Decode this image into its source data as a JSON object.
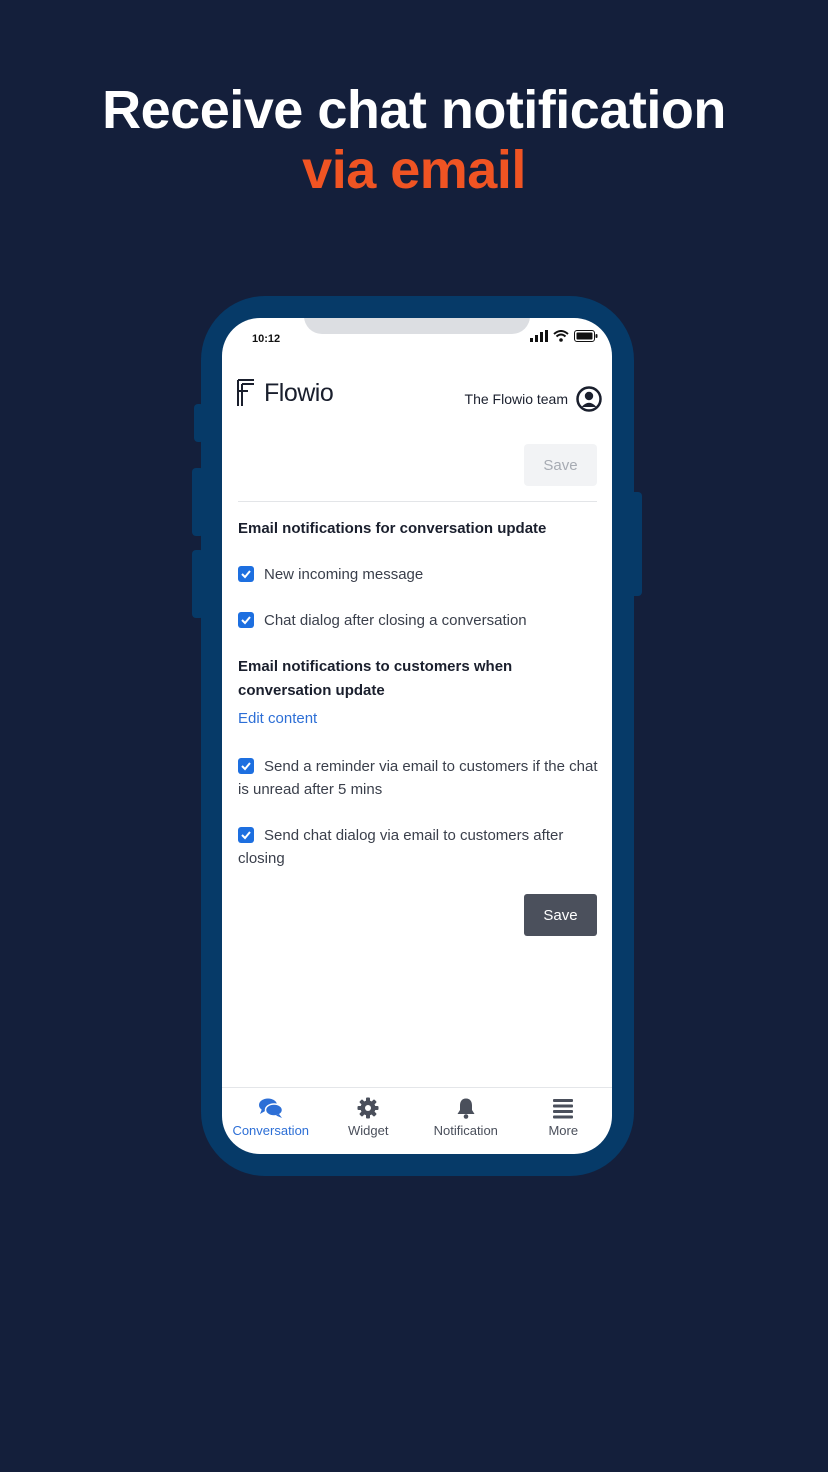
{
  "hero": {
    "line1": "Receive chat notification",
    "line2": "via email"
  },
  "colors": {
    "background": "#141f3b",
    "accent": "#f05423",
    "phone_frame": "#063a68",
    "link": "#2d6fd6",
    "checkbox": "#1d6fe0"
  },
  "status_bar": {
    "time": "10:12",
    "icons": [
      "signal-icon",
      "wifi-icon",
      "battery-icon"
    ]
  },
  "header": {
    "brand": "Flowio",
    "account_name": "The Flowio team",
    "account_icon": "user-circle-icon"
  },
  "top_save": {
    "label": "Save",
    "state": "disabled"
  },
  "section1": {
    "title": "Email notifications for conversation update",
    "options": [
      {
        "label": "New incoming message",
        "checked": true
      },
      {
        "label": "Chat dialog after closing a conversation",
        "checked": true
      }
    ]
  },
  "section2": {
    "title": "Email notifications to customers when conversation update",
    "link": "Edit content",
    "options": [
      {
        "label": "Send a reminder via email to customers if the chat is unread after 5 mins",
        "checked": true
      },
      {
        "label": "Send chat dialog via email to customers after closing",
        "checked": true
      }
    ]
  },
  "bottom_save": {
    "label": "Save"
  },
  "nav": {
    "items": [
      {
        "label": "Conversation",
        "icon": "chat-bubbles-icon",
        "active": true
      },
      {
        "label": "Widget",
        "icon": "gear-icon",
        "active": false
      },
      {
        "label": "Notification",
        "icon": "bell-icon",
        "active": false
      },
      {
        "label": "More",
        "icon": "menu-icon",
        "active": false
      }
    ]
  }
}
